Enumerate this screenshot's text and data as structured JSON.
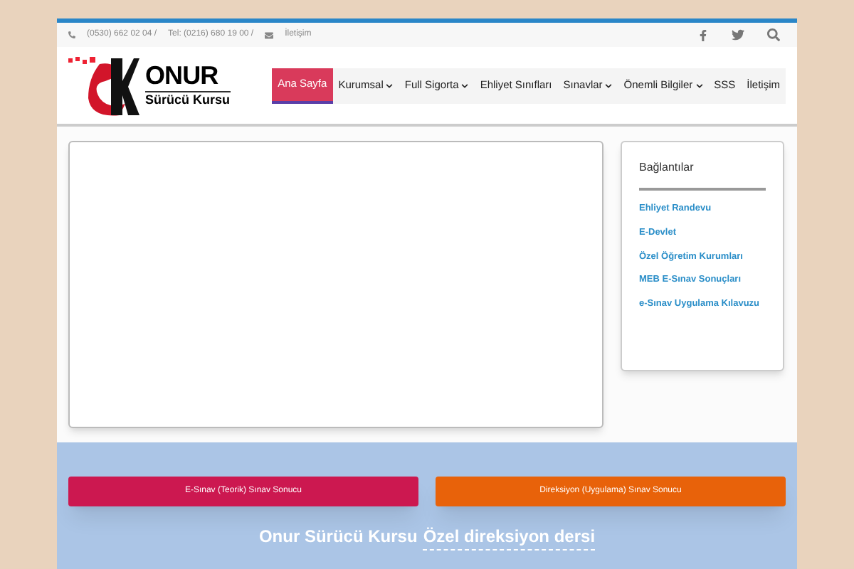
{
  "top_bar": {
    "phone": "(0530) 662 02 04 /",
    "tel": "Tel: (0216) 680 19 00 /",
    "contact": "İletişim"
  },
  "logo": {
    "title": "ONUR",
    "subtitle": "Sürücü Kursu"
  },
  "nav": [
    {
      "label": "Ana Sayfa",
      "selected": true,
      "kind": "link"
    },
    {
      "label": "Kurumsal",
      "selected": false,
      "kind": "dropdown"
    },
    {
      "label": "Full Sigorta",
      "selected": false,
      "kind": "dropdown"
    },
    {
      "label": "Ehliyet Sınıfları",
      "selected": false,
      "kind": "link"
    },
    {
      "label": "Sınavlar",
      "selected": false,
      "kind": "dropdown"
    },
    {
      "label": "Önemli Bilgiler",
      "selected": false,
      "kind": "dropdown"
    },
    {
      "label": "SSS",
      "selected": false,
      "kind": "link"
    },
    {
      "label": "İletişim",
      "selected": false,
      "kind": "link"
    }
  ],
  "sidebar": {
    "title": "Bağlantılar",
    "links": [
      "Ehliyet Randevu",
      "E-Devlet",
      "Özel Öğretim Kurumları",
      "MEB E-Sınav Sonuçları",
      "e-Sınav Uygulama Kılavuzu"
    ]
  },
  "buttons": [
    {
      "label": "E-Sınav (Teorik) Sınav Sonucu",
      "color": "#cc1850"
    },
    {
      "label": "Direksiyon (Uygulama) Sınav Sonucu",
      "color": "#e8620a"
    }
  ],
  "banner": {
    "text": "Onur Sürücü Kursu",
    "link": "Özel direksiyon dersi"
  }
}
